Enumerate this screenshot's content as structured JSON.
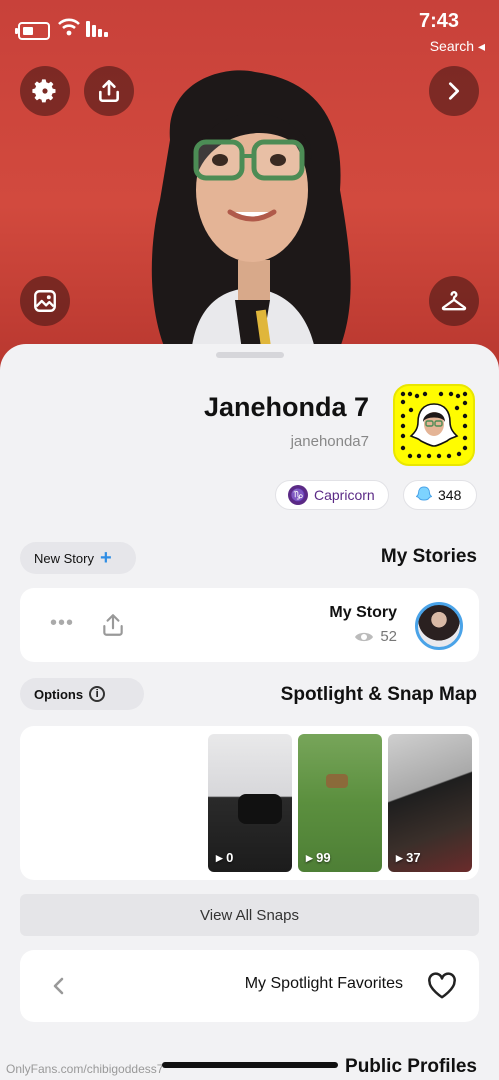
{
  "status_bar": {
    "time": "7:43",
    "back_link": "Search ◂"
  },
  "profile": {
    "display_name": "Janehonda 7",
    "username": "janehonda7",
    "friends_count": "348",
    "zodiac": "Capricorn",
    "zodiac_glyph": "♑"
  },
  "my_stories": {
    "title": "My Stories",
    "new_story_label": "New Story",
    "story_name": "My Story",
    "views": "52"
  },
  "spotlight": {
    "title": "Spotlight & Snap Map",
    "options_label": "Options",
    "tiles": [
      {
        "count": "37"
      },
      {
        "count": "99"
      },
      {
        "count": "0"
      }
    ],
    "view_all_label": "View All Snaps",
    "favorites_label": "My Spotlight Favorites"
  },
  "public_profiles": {
    "title": "Public Profiles"
  },
  "watermark": "OnlyFans.com/chibigoddess7",
  "colors": {
    "hero_bg": "#cc4339",
    "snap_yellow": "#fffc00",
    "story_ring": "#4aa3e8",
    "zodiac_purple": "#5b2a86"
  },
  "icons": [
    "gear-icon",
    "share-icon",
    "chevron-right-icon",
    "wallpaper-icon",
    "hanger-icon",
    "ghost-icon",
    "plus-icon",
    "info-icon",
    "eye-icon",
    "ellipsis-icon",
    "heart-icon",
    "chevron-left-icon"
  ]
}
